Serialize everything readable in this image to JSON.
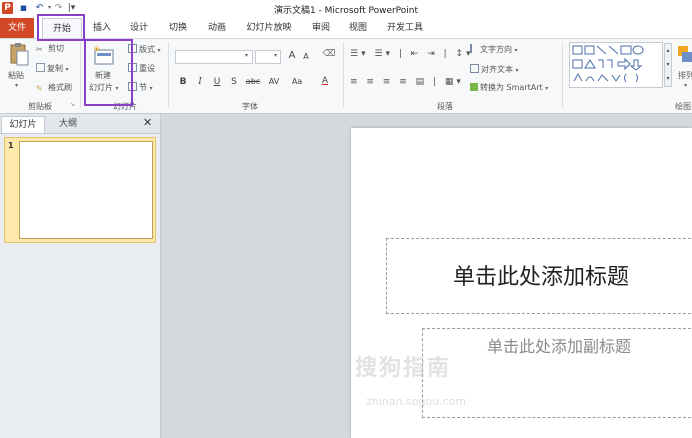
{
  "window": {
    "title": "演示文稿1 - Microsoft PowerPoint"
  },
  "qat": {
    "app_icon": "P",
    "save_icon": "save-icon",
    "undo_icon": "undo-icon",
    "redo_icon": "redo-icon"
  },
  "tabs": [
    "文件",
    "开始",
    "插入",
    "设计",
    "切换",
    "动画",
    "幻灯片放映",
    "审阅",
    "视图",
    "开发工具"
  ],
  "clipboard": {
    "paste": "粘贴",
    "cut": "剪切",
    "copy": "复制",
    "format_painter": "格式刷",
    "label": "剪贴板"
  },
  "slides_group": {
    "new_slide_line1": "新建",
    "new_slide_line2": "幻灯片",
    "layout": "版式",
    "reset": "重设",
    "section": "节",
    "label": "幻灯片"
  },
  "font_group": {
    "grow": "A",
    "shrink": "A",
    "bold": "B",
    "italic": "I",
    "underline": "U",
    "strike": "S",
    "shadow": "abc",
    "spacing": "AV",
    "case": "Aa",
    "color": "A",
    "label": "字体"
  },
  "paragraph_group": {
    "text_direction": "文字方向",
    "align_text": "对齐文本",
    "smartart": "转换为 SmartArt",
    "label": "段落"
  },
  "drawing_group": {
    "arrange": "排列",
    "label": "绘图"
  },
  "left_panel": {
    "tab_slides": "幻灯片",
    "tab_outline": "大纲",
    "close": "✕",
    "slide_number": "1"
  },
  "slide": {
    "title_placeholder": "单击此处添加标题",
    "subtitle_placeholder": "单击此处添加副标题"
  },
  "watermark": {
    "text": "搜狗指南",
    "url": "zhinan.sogou.com"
  },
  "colors": {
    "file_tab": "#d24726",
    "highlight": "#8a3fc7",
    "thumb_selected": "#fde9a9"
  }
}
